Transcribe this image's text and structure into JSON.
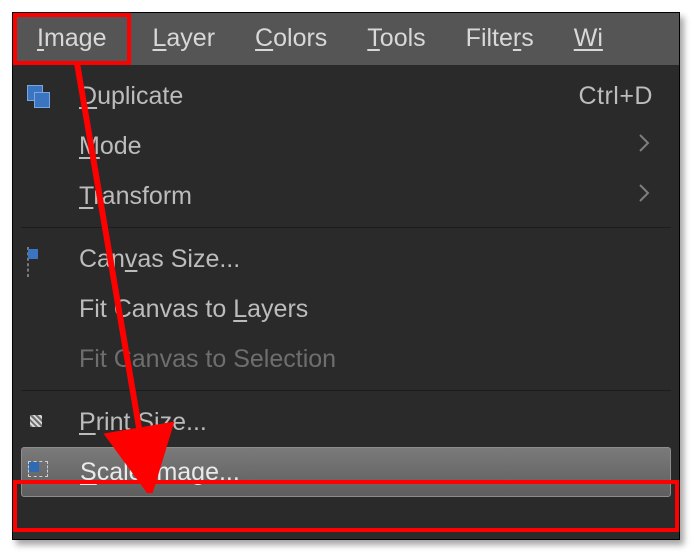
{
  "menubar": {
    "image": {
      "pre": "I",
      "rest": "mage"
    },
    "layer": {
      "pre": "L",
      "rest": "ayer"
    },
    "colors": {
      "pre": "C",
      "rest": "olors"
    },
    "tools": {
      "pre": "T",
      "rest": "ools"
    },
    "filters": {
      "lead": "Filte",
      "u": "r",
      "tail": "s"
    },
    "last_partial": "Wi"
  },
  "dropdown": {
    "duplicate": {
      "u": "D",
      "rest": "uplicate",
      "shortcut": "Ctrl+D"
    },
    "mode": {
      "u": "M",
      "rest": "ode"
    },
    "transform": {
      "u": "T",
      "rest": "ransform"
    },
    "canvas_size": {
      "lead": "Can",
      "u": "v",
      "tail": "as Size..."
    },
    "fit_layers": {
      "lead": "Fit Canvas to ",
      "u": "L",
      "tail": "ayers"
    },
    "fit_sel": {
      "text": "Fit Canvas to Selection"
    },
    "print_size": {
      "u": "P",
      "rest": "rint Size..."
    },
    "scale": {
      "u": "S",
      "rest": "cale Image..."
    }
  },
  "annotation": {
    "highlight_color": "#ff0000"
  }
}
